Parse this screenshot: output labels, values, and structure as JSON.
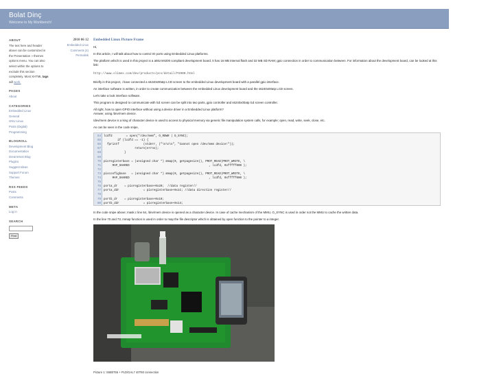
{
  "header": {
    "title": "Bolat Dinç",
    "description": "Welcome to My Workbench!"
  },
  "sidebar": {
    "about_heading": "ABOUT",
    "about_text_1": "The text here and header above can be customized in the Presentation » themes options menu. You can also select within the options to exclude this section completely. Most XHTML",
    "about_tags": "tags",
    "about_text_2": "will",
    "about_work": "work.",
    "pages_heading": "PAGES",
    "pages": [
      "About"
    ],
    "categories_heading": "CATEGORIES",
    "categories": [
      "Embedded Linux",
      "General",
      "GNU Linux",
      "Posts (Digital)",
      "Programming"
    ],
    "blogroll_heading": "BLOGROLL",
    "blogroll": [
      "Development Blog",
      "Documentation",
      "DreamHost Blog",
      "Plugins",
      "Suggest Ideas",
      "Support Forum",
      "Themes"
    ],
    "rss_heading": "RSS FEEDS",
    "rss": [
      "Posts",
      "Comments"
    ],
    "meta_heading": "META",
    "meta": [
      "Log in"
    ],
    "search_heading": "SEARCH",
    "search_button": "Find"
  },
  "post_meta": {
    "date": "2010 06 12",
    "category": "Embedded Linux",
    "comments": "Comments (4)",
    "permalink": "Permalink"
  },
  "post": {
    "title": "Embedded Linux Picture Frame",
    "p1": "Hi,",
    "p2": "In this article, I will talk about how to control IO ports using Embedded Linux platforms.",
    "p3": "The platform which is used in this project is a at91rm9200 compliant development board. It has 16 MB internal flash and 32 MB SD RAM; gpio connection in order to communication between. For information about the development board, can be looked at this link:",
    "url": "http://www.olimex.com/dev/products/pcs/detail/P2900.html",
    "p4": "Briefly in this project, i have connected a s6240x00atp LCD screen to the embedded Linux development board with a parallel gpio interface.",
    "p5": "An interface software is written, in order to create communication between the embedded Linux development board and the s6240x00atp LCD screen.",
    "p6": "Let's take a look interface software.",
    "p7": "This program is designed to communicate with lcd screen can be split into two parts, gpio controller and s6240x00atp lcd screen controller.",
    "p8a": "All right, how to open GPIO interface without using a device driver in a Embedded Linux platform?",
    "p8b": "Answer, using /dev/mem device.",
    "p9": "/dev/mem device is a king of character device is used to access to physical memory via generic file manipulation system calls, for example; open, read, write, seek, close, etc.",
    "p10": "As can be seen in the code snipe,",
    "p11": "In the code snipe above; mask.c line 64, /dev/mem device is opened as a character device. In case of cache mechanism of the MMU, O_SYNC is used in order not the MMU to cache the written data.",
    "p12": "In the line 70 and 73, mmap function is used in order to map the file descriptor which is obtained by open function to the pointer to a integer.",
    "caption": "Picture 1: S6B0755 + PLD/GAL7 40T60 connection"
  },
  "code": {
    "lines": [
      {
        "n": "64",
        "t": "lcdfd        = open(\"/dev/mem\", O_RDWR | O_SYNC);"
      },
      {
        "n": "65",
        "t": "        if (lcdfd == -1) {"
      },
      {
        "n": "66",
        "t": "  fprintf              (stderr, (\"\\n\\n\\n\", \"Cannot open /dev/mem device!\"));"
      },
      {
        "n": "67",
        "t": "                  return(errno);"
      },
      {
        "n": "68",
        "t": "            }"
      },
      {
        "n": "69",
        "t": ""
      },
      {
        "n": "70",
        "t": "pioregisterbase = (unsigned char *) mmap(0, getpagesize(), PROT_READ|PROT_WRITE, \\"
      },
      {
        "n": "71",
        "t": "     MAP_SHARED                                              , lcdfd, 0xfffff000 );"
      },
      {
        "n": "72",
        "t": ""
      },
      {
        "n": "73",
        "t": "pioconfigbase   = (unsigned char *) mmap(0, getpagesize(), PROT_READ|PROT_WRITE, \\"
      },
      {
        "n": "74",
        "t": "     MAP_SHARED                                              , lcdfd, 0xfffff000 );"
      },
      {
        "n": "75",
        "t": ""
      },
      {
        "n": "76",
        "t": "porta_dr    = pioregisterbase+0x20;  //data register//"
      },
      {
        "n": "77",
        "t": "porta_ddr              = pioregisterbase+0x1C; //data direction register//"
      },
      {
        "n": "78",
        "t": ""
      },
      {
        "n": "79",
        "t": "portb_dr    = pioregisterbase+0x10;"
      },
      {
        "n": "80",
        "t": "portb_ddr              = pioregisterbase+0x14;"
      }
    ]
  }
}
